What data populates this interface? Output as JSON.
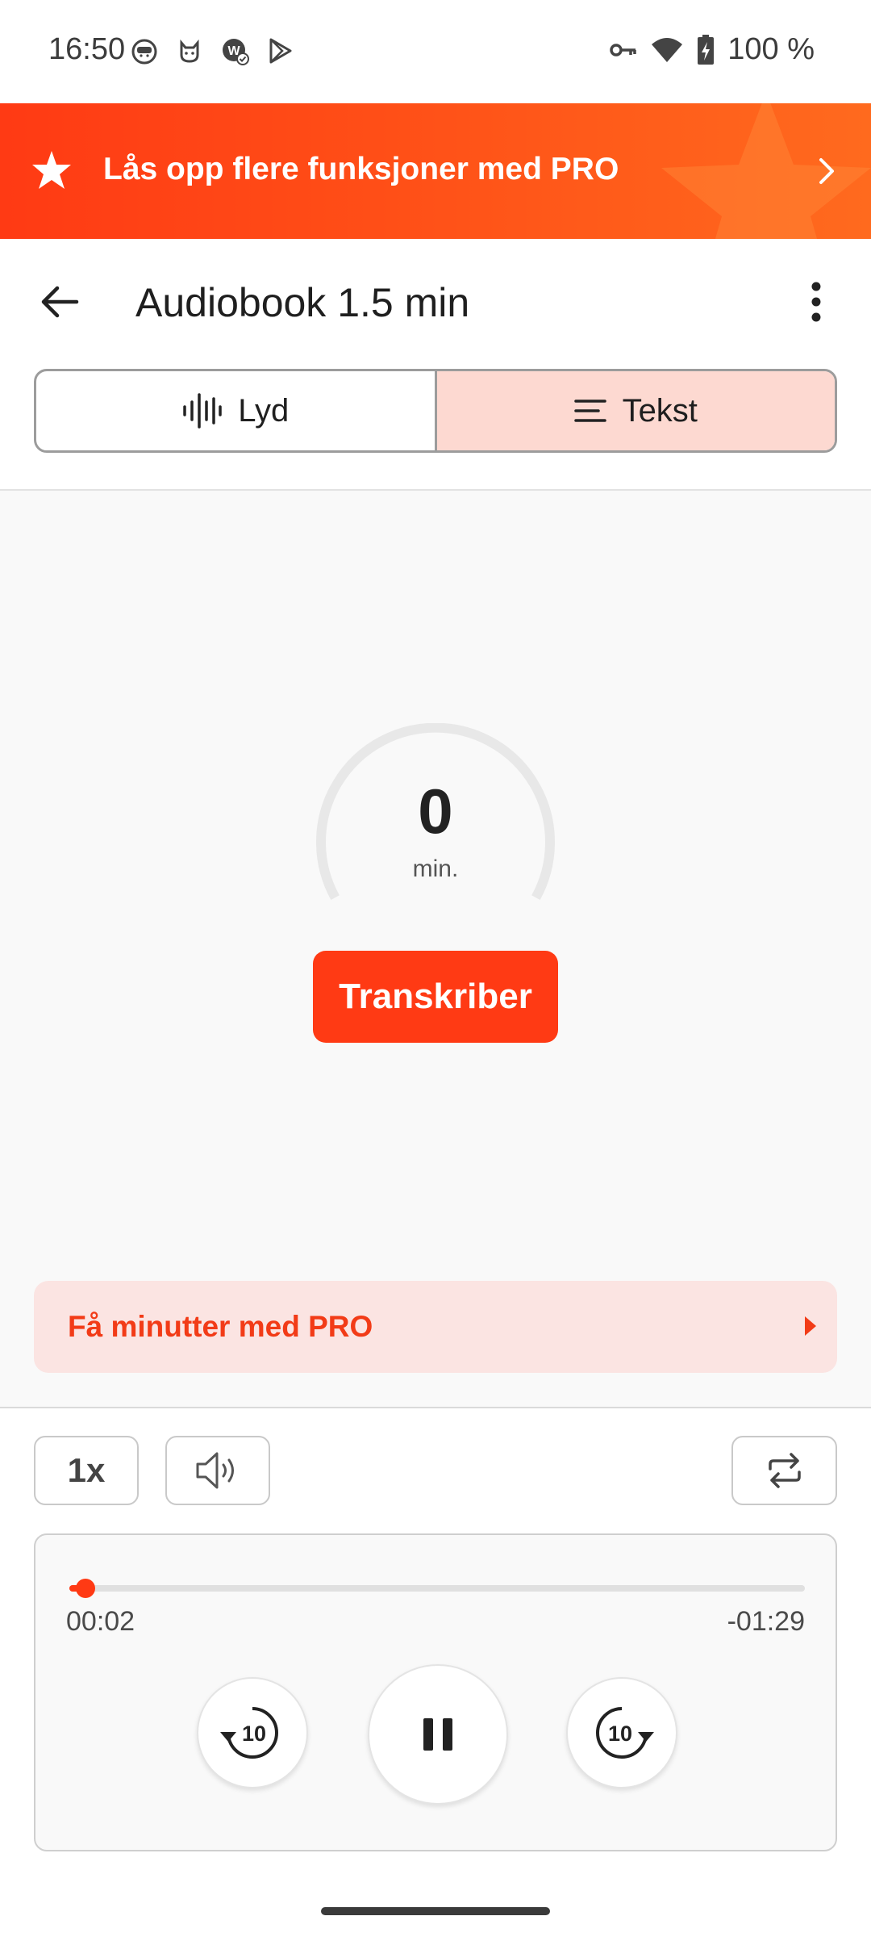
{
  "status_bar": {
    "time": "16:50",
    "battery": "100 %",
    "left_icons": [
      "face-icon",
      "cat-icon",
      "app-badge-icon",
      "play-store-icon"
    ],
    "right_icons": [
      "vpn-key-icon",
      "wifi-icon",
      "battery-charging-icon"
    ]
  },
  "promo": {
    "text": "Lås opp flere funksjoner med PRO",
    "color": "#ff4a16"
  },
  "header": {
    "title": "Audiobook 1.5 min"
  },
  "tabs": [
    {
      "label": "Lyd",
      "icon": "waveform-icon",
      "active": false
    },
    {
      "label": "Tekst",
      "icon": "text-lines-icon",
      "active": true
    }
  ],
  "gauge": {
    "value": "0",
    "unit": "min."
  },
  "transcribe": {
    "label": "Transkriber",
    "color": "#ff3a14"
  },
  "pro_row": {
    "label": "Få minutter med PRO"
  },
  "controls": {
    "speed_label": "1x",
    "volume_icon": "speaker-icon",
    "repeat_icon": "repeat-icon"
  },
  "player": {
    "elapsed": "00:02",
    "remaining": "-01:29",
    "progress_fraction": 0.022,
    "rewind_label": "10",
    "forward_label": "10",
    "state": "playing"
  }
}
